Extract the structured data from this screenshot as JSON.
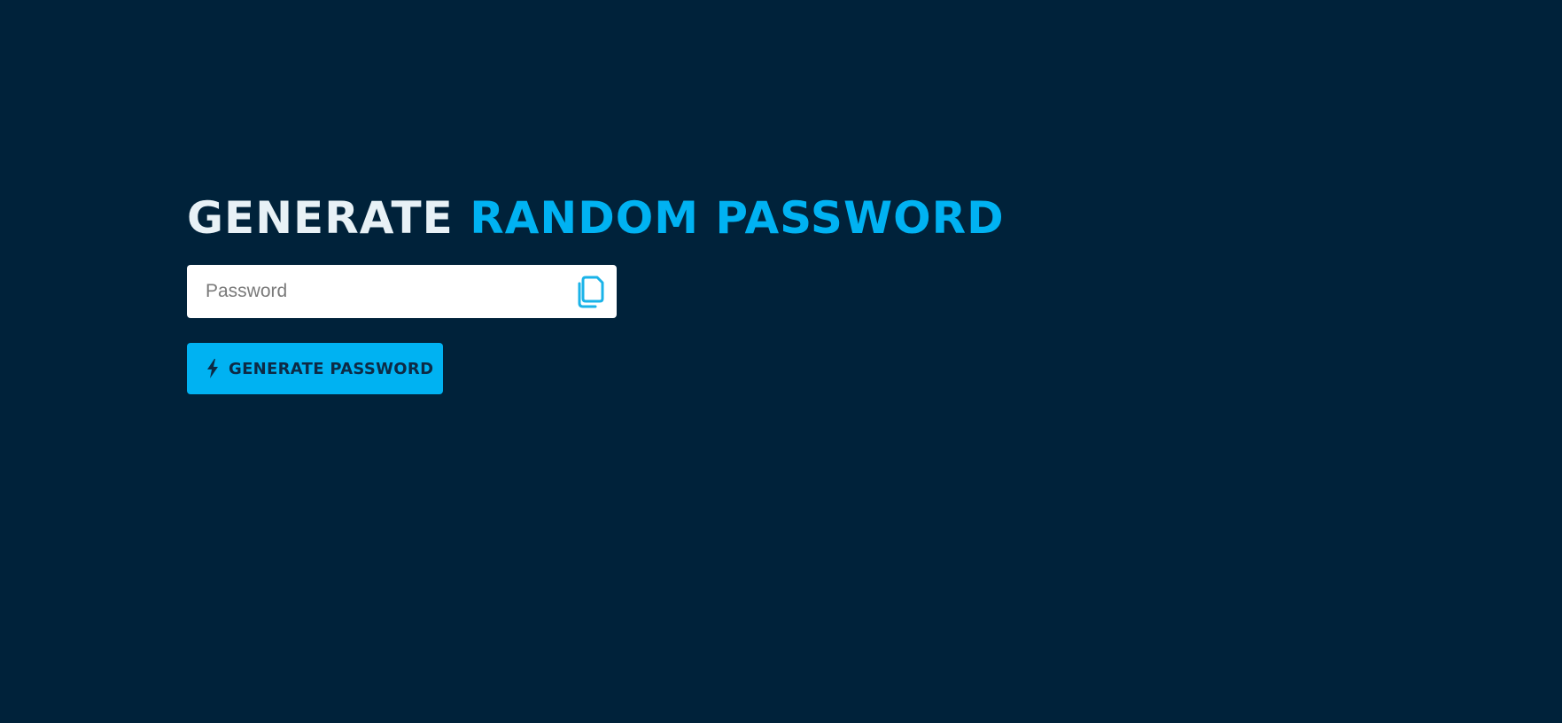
{
  "heading": {
    "part1": "GENERATE",
    "part2": "RANDOM PASSWORD"
  },
  "password_field": {
    "placeholder": "Password",
    "value": ""
  },
  "copy_button": {
    "icon": "copy-icon"
  },
  "generate_button": {
    "icon": "lightning-bolt-icon",
    "label": "GENERATE PASSWORD"
  },
  "colors": {
    "background": "#00223a",
    "accent": "#00b2f2",
    "heading_light": "#e8f1f6",
    "button_text": "#0d2a45"
  }
}
